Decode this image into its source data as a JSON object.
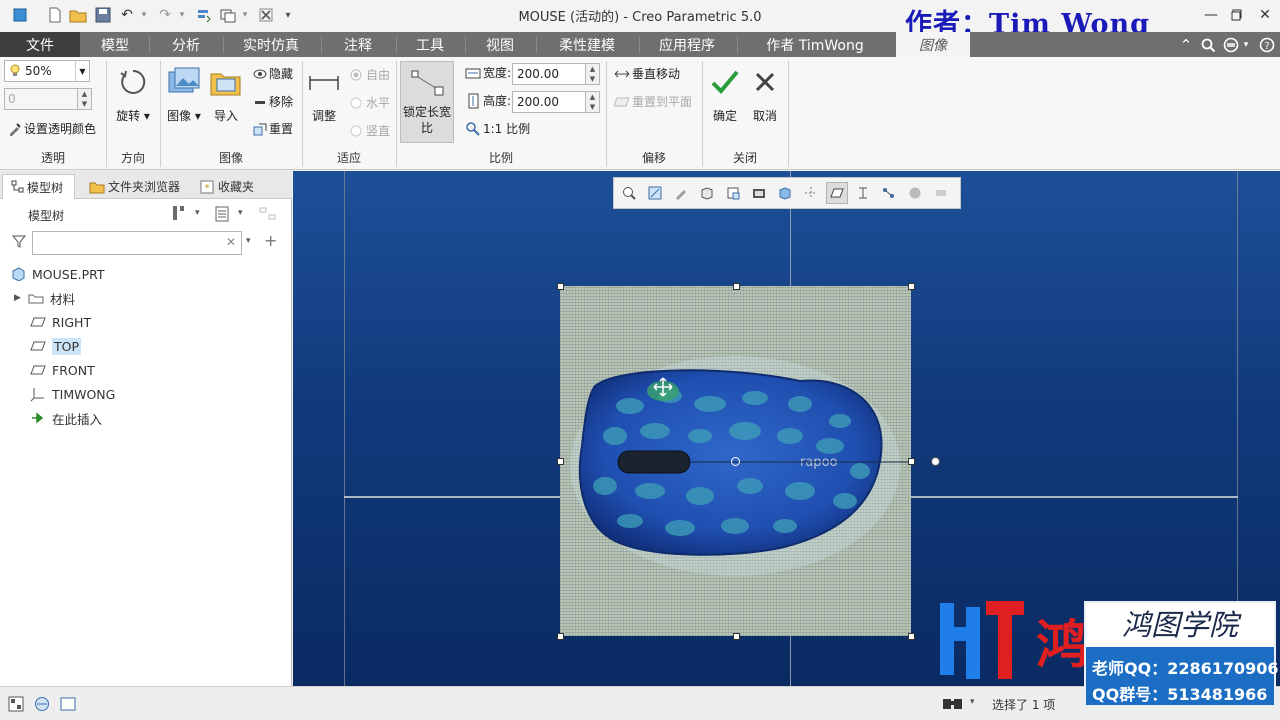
{
  "window": {
    "title": "MOUSE (活动的) - Creo Parametric 5.0",
    "author_overlay": "作者：Tim Wong"
  },
  "tabs": {
    "file": "文件",
    "items": [
      "模型",
      "分析",
      "实时仿真",
      "注释",
      "工具",
      "视图",
      "柔性建模",
      "应用程序",
      "作者 TimWong"
    ],
    "active": "图像"
  },
  "ribbon": {
    "transparency": {
      "value": "50%",
      "value2": "0",
      "set_color": "设置透明颜色",
      "label": "透明"
    },
    "orientation": {
      "rotate": "旋转",
      "label": "方向"
    },
    "image": {
      "image": "图像",
      "import": "导入",
      "hide": "隐藏",
      "remove": "移除",
      "reset": "重置",
      "label": "图像"
    },
    "fit": {
      "adjust": "调整",
      "free": "自由",
      "horizontal": "水平",
      "vertical": "竖直",
      "label": "适应"
    },
    "scale": {
      "lock_ratio": "锁定长宽比",
      "width_label": "宽度:",
      "width": "200.00",
      "height_label": "高度:",
      "height": "200.00",
      "one_to_one": "1:1 比例",
      "label": "比例"
    },
    "offset": {
      "vertical_move": "垂直移动",
      "reset_to_plane": "重置到平面",
      "label": "偏移"
    },
    "close": {
      "ok": "确定",
      "cancel": "取消",
      "label": "关闭"
    }
  },
  "left_panel": {
    "tabs": [
      "模型树",
      "文件夹浏览器",
      "收藏夹"
    ],
    "header": "模型树",
    "search_placeholder": "",
    "tree": [
      {
        "label": "MOUSE.PRT",
        "icon": "part-icon"
      },
      {
        "label": "材料",
        "icon": "material-icon"
      },
      {
        "label": "RIGHT",
        "icon": "datum-plane-icon"
      },
      {
        "label": "TOP",
        "icon": "datum-plane-icon"
      },
      {
        "label": "FRONT",
        "icon": "datum-plane-icon"
      },
      {
        "label": "TIMWONG",
        "icon": "coordinate-system-icon"
      },
      {
        "label": "在此插入",
        "icon": "insert-here-icon"
      }
    ],
    "selected": "TOP"
  },
  "viewport": {
    "mouse_brand": "rapoo"
  },
  "status": {
    "selection": "选择了 1 项"
  },
  "watermark": {
    "ht": "HT鸿",
    "title": "鸿图学院",
    "teacher_qq": "老师QQ：2286170906",
    "group_qq": "QQ群号：513481966"
  },
  "colors": {
    "tabbar": "#6f6f6f",
    "file_tab": "#3e3e3e",
    "viewport_top": "#1d4f98",
    "viewport_bottom": "#0a2a62",
    "ok_green": "#2a9d3a",
    "watermark_blue": "#1c6ec4",
    "watermark_red": "#e02020"
  }
}
